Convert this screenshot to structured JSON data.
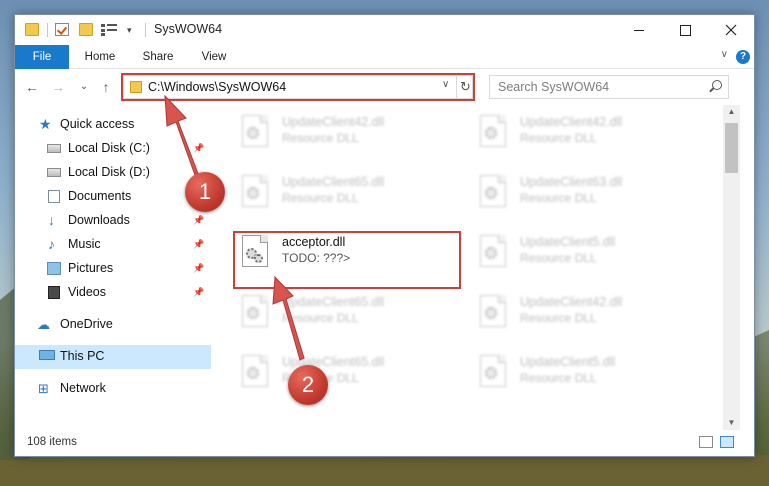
{
  "window": {
    "title": "SysWOW64"
  },
  "ribbon": {
    "tabs": [
      "File",
      "Home",
      "Share",
      "View"
    ],
    "help": "?"
  },
  "navigation": {
    "back": "←",
    "forward": "→",
    "recent": "⌄",
    "up": "↑",
    "address": "C:\\Windows\\SysWOW64",
    "refresh": "↻",
    "search_placeholder": "Search SysWOW64"
  },
  "sidebar": {
    "items": [
      {
        "label": "Quick access",
        "icon": "star-icon",
        "pinned": false
      },
      {
        "label": "Local Disk (C:)",
        "icon": "disk-icon",
        "pinned": true
      },
      {
        "label": "Local Disk (D:)",
        "icon": "disk-icon",
        "pinned": false
      },
      {
        "label": "Documents",
        "icon": "documents-icon",
        "pinned": true
      },
      {
        "label": "Downloads",
        "icon": "downloads-icon",
        "pinned": true
      },
      {
        "label": "Music",
        "icon": "music-icon",
        "pinned": true
      },
      {
        "label": "Pictures",
        "icon": "pictures-icon",
        "pinned": true
      },
      {
        "label": "Videos",
        "icon": "videos-icon",
        "pinned": true
      },
      {
        "label": "OneDrive",
        "icon": "onedrive-icon",
        "pinned": false
      },
      {
        "label": "This PC",
        "icon": "pc-icon",
        "pinned": false,
        "selected": true
      },
      {
        "label": "Network",
        "icon": "network-icon",
        "pinned": false
      }
    ]
  },
  "files": {
    "left": [
      {
        "name": "UpdateClient42.dll",
        "desc": "Resource DLL"
      },
      {
        "name": "UpdateClient65.dll",
        "desc": "Resource DLL"
      },
      {
        "name": "acceptor.dll",
        "desc": "TODO: ???>",
        "highlighted": true
      },
      {
        "name": "UpdateClient65.dll",
        "desc": "Resource DLL"
      },
      {
        "name": "UpdateClient65.dll",
        "desc": "Resource DLL"
      }
    ],
    "right": [
      {
        "name": "UpdateClient42.dll",
        "desc": "Resource DLL"
      },
      {
        "name": "UpdateClient63.dll",
        "desc": "Resource DLL"
      },
      {
        "name": "UpdateClient5.dll",
        "desc": "Resource DLL"
      },
      {
        "name": "UpdateClient42.dll",
        "desc": "Resource DLL"
      },
      {
        "name": "UpdateClient5.dll",
        "desc": "Resource DLL"
      }
    ]
  },
  "status": {
    "item_count": "108 items"
  },
  "annotations": {
    "step1": "1",
    "step2": "2",
    "color": "#c8413c"
  }
}
